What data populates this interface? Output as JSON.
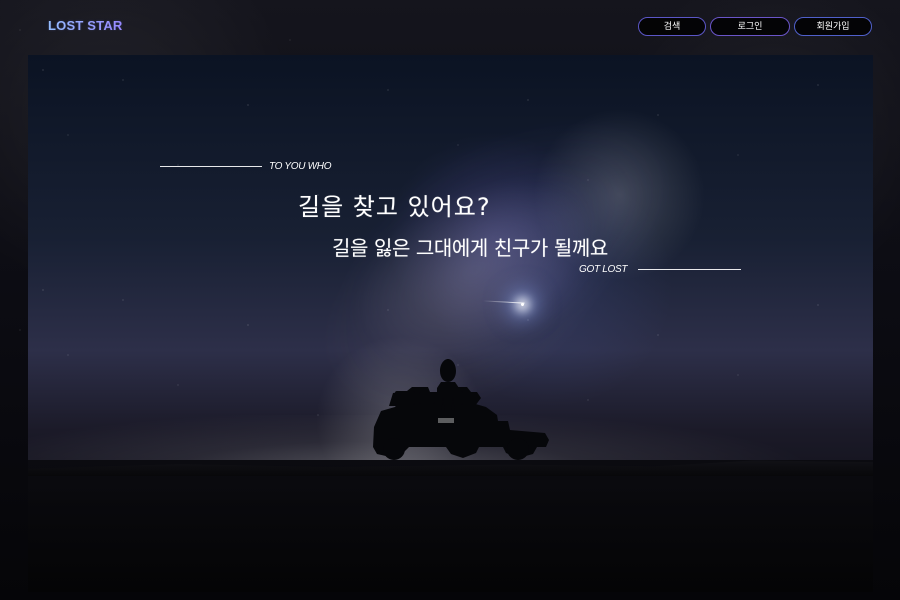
{
  "header": {
    "logo": "LOST STAR",
    "nav": {
      "search": "검색",
      "login": "로그인",
      "signup": "회원가입"
    }
  },
  "hero": {
    "eyebrow_top": "TO YOU WHO",
    "headline": "길을 찾고 있어요?",
    "subheadline": "길을 잃은 그대에게 친구가 될께요",
    "eyebrow_bottom": "GOT LOST"
  }
}
